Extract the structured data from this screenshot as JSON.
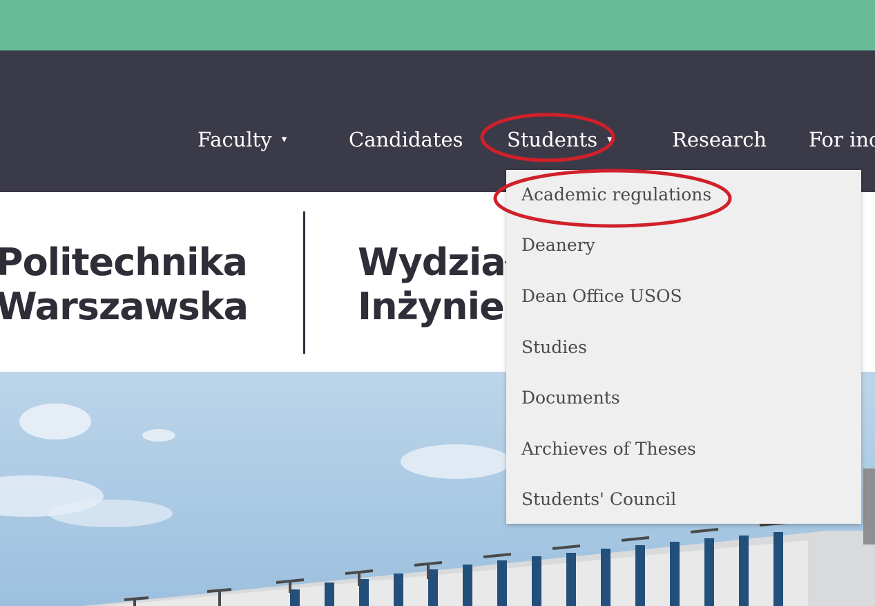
{
  "nav": {
    "items": [
      {
        "label": "Faculty",
        "has_dropdown": true
      },
      {
        "label": "Candidates",
        "has_dropdown": false
      },
      {
        "label": "Students",
        "has_dropdown": true
      },
      {
        "label": "Research",
        "has_dropdown": false
      },
      {
        "label": "For inc",
        "has_dropdown": false
      }
    ],
    "dropdown_caret": "▾"
  },
  "logos": {
    "university": {
      "line1": "Politechnika",
      "line2": "Warszawska"
    },
    "faculty": {
      "line1": "Wydział",
      "line2": "Inżynier"
    }
  },
  "students_dropdown": {
    "items": [
      "Academic regulations",
      "Deanery",
      "Dean Office USOS",
      "Studies",
      "Documents",
      "Archieves of Theses",
      "Students' Council"
    ]
  },
  "colors": {
    "topbar": "#68bb98",
    "navbar": "#3b3a48",
    "dropdown_bg": "#efefef",
    "annotation_red": "#d0202a"
  }
}
